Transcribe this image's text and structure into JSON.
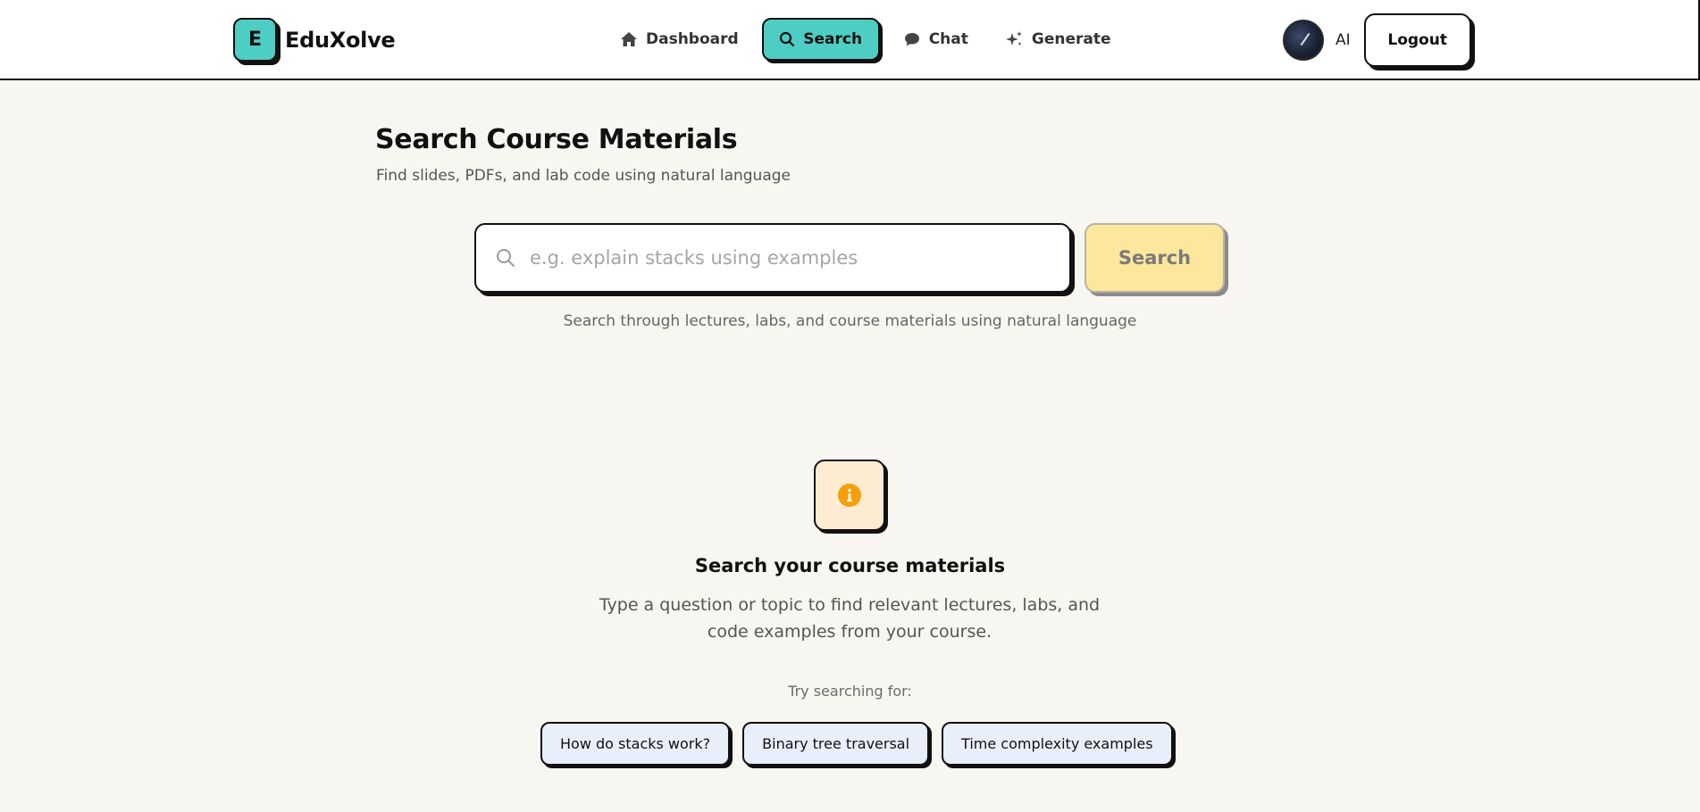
{
  "brand": {
    "logo_letter": "E",
    "name": "EduXolve"
  },
  "nav": {
    "items": [
      {
        "label": "Dashboard",
        "icon": "home-icon",
        "active": false
      },
      {
        "label": "Search",
        "icon": "search-icon",
        "active": true
      },
      {
        "label": "Chat",
        "icon": "chat-icon",
        "active": false
      },
      {
        "label": "Generate",
        "icon": "sparkles-icon",
        "active": false
      }
    ]
  },
  "user": {
    "name": "AI",
    "logout_label": "Logout"
  },
  "page": {
    "title": "Search Course Materials",
    "subtitle": "Find slides, PDFs, and lab code using natural language"
  },
  "search": {
    "placeholder": "e.g. explain stacks using examples",
    "value": "",
    "button_label": "Search",
    "hint": "Search through lectures, labs, and course materials using natural language"
  },
  "empty_state": {
    "icon": "info-icon",
    "title": "Search your course materials",
    "description": "Type a question or topic to find relevant lectures, labs, and code examples from your course.",
    "try_label": "Try searching for:",
    "suggestions": [
      "How do stacks work?",
      "Binary tree traversal",
      "Time complexity examples"
    ]
  },
  "colors": {
    "accent": "#4ecdc4",
    "background": "#f8f6f1",
    "search_button": "#fde79c",
    "info_badge": "#fdebd2",
    "info_icon": "#f59e0b",
    "chip": "#e8effb"
  }
}
